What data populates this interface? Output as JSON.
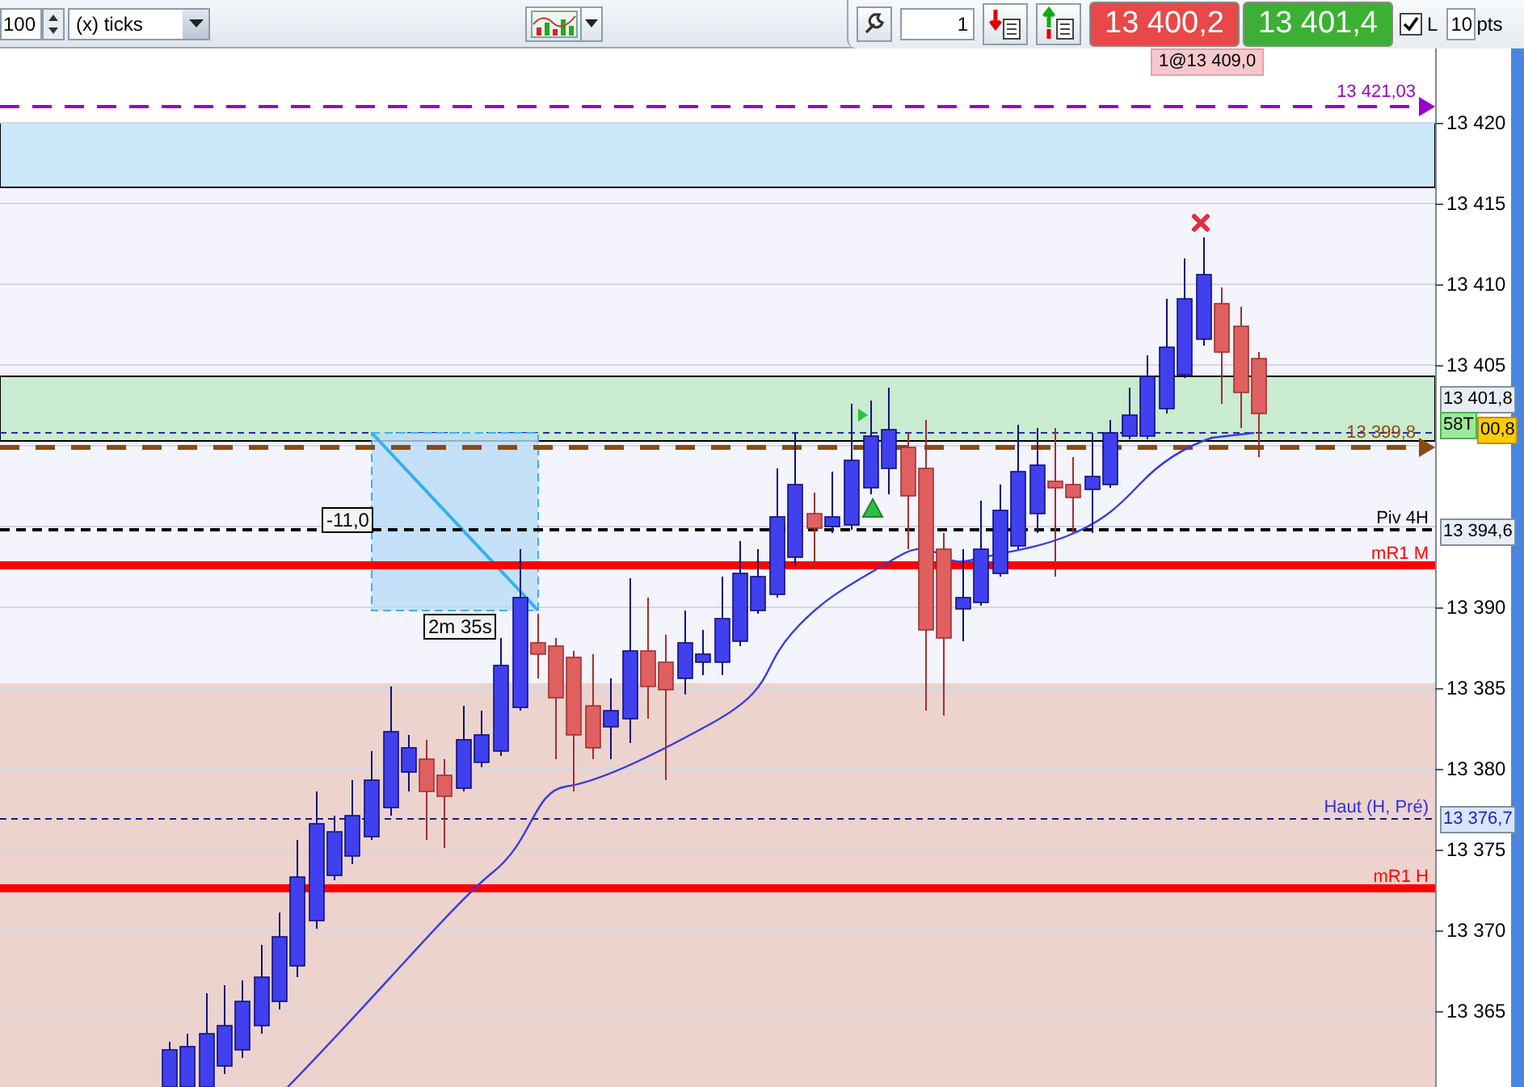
{
  "toolbar": {
    "quantity": "100",
    "unit_dropdown": "(x) ticks",
    "order_quantity": "1",
    "sell_price": "13 400,2",
    "buy_price": "13 401,4",
    "limit_checkbox": {
      "label": "L",
      "checked": true
    },
    "points_input": "10",
    "points_unit": "pts"
  },
  "order_badge": "1@13 409,0",
  "chart": {
    "y_axis_ticks": [
      "13 420",
      "13 415",
      "13 410",
      "13 405",
      "13 390",
      "13 385",
      "13 380",
      "13 375",
      "13 370",
      "13 365"
    ],
    "levels": [
      {
        "label": "13 421,03",
        "kind": "target"
      },
      {
        "label": "13 399,8",
        "kind": "average"
      },
      {
        "label": "Piv 4H",
        "kind": "pivot"
      },
      {
        "label": "mR1 M",
        "kind": "resistance"
      },
      {
        "label": "Haut (H, Pré)",
        "kind": "high"
      },
      {
        "label": "mR1 H",
        "kind": "resistance"
      }
    ],
    "price_tags": [
      {
        "text": "13 401,8",
        "kind": "plain"
      },
      {
        "text": "58T",
        "kind": "timer"
      },
      {
        "text": "00,8",
        "kind": "last"
      },
      {
        "text": "13 394,6",
        "kind": "plain"
      },
      {
        "text": "13 376,7",
        "kind": "highlight"
      }
    ],
    "measure": {
      "price_change": "-11,0",
      "duration": "2m 35s"
    }
  }
}
